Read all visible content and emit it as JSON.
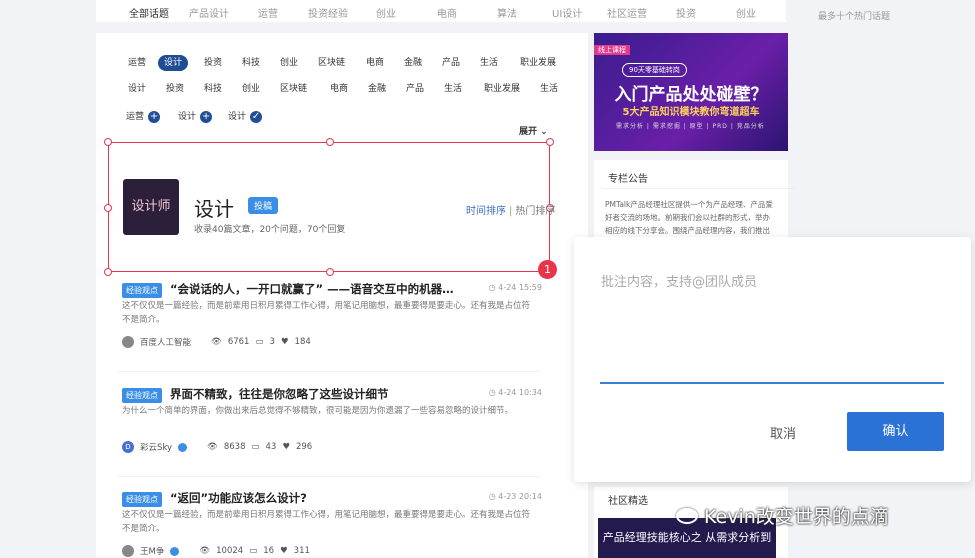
{
  "topnav": {
    "items": [
      "全部话题",
      "产品设计",
      "运营",
      "投资经验",
      "创业",
      "电商",
      "算法",
      "UI设计",
      "社区运营",
      "投资",
      "创业"
    ],
    "hot_caption": "最多十个热门话题"
  },
  "tags": {
    "row1": [
      "运营",
      "设计",
      "投资",
      "科技",
      "创业",
      "区块链",
      "电商",
      "金融",
      "产品",
      "生活",
      "职业发展"
    ],
    "row2": [
      "设计",
      "投资",
      "科技",
      "创业",
      "区块链",
      "电商",
      "金融",
      "产品",
      "生活",
      "职业发展",
      "生活"
    ],
    "chips": [
      {
        "label": "运营",
        "icon": "+"
      },
      {
        "label": "设计",
        "icon": "+"
      },
      {
        "label": "设计",
        "icon": "✓"
      }
    ],
    "expand_label": "展开 ⌄",
    "selected_row1_index": 1
  },
  "topic": {
    "logo_text": "设计师",
    "title": "设计",
    "submit_label": "投稿",
    "stats": "收录40篇文章，20个问题，70个回复",
    "sort_time": "时间排序",
    "sort_hot": "热门排序",
    "selection_badge": "1"
  },
  "articles": [
    {
      "badge": "经验观点",
      "title": "“会说话的人，一开口就赢了” ——语音交互中的机器…",
      "time": "4-24 15:59",
      "excerpt": "这不仅仅是一篇经验，而是前辈用日积月累得工作心得，用笔记用脑想，最重要得是要走心。还有我是占位符不是简介。",
      "author": "百度人工智能",
      "views": "6761",
      "comments": "3",
      "likes": "184"
    },
    {
      "badge": "经验观点",
      "title": "界面不精致，往往是你忽略了这些设计细节",
      "time": "4-24 10:34",
      "excerpt": "为什么一个简单的界面，你做出来后总觉得不够精致，很可能是因为你遗漏了一些容易忽略的设计细节。",
      "author": "彩云Sky",
      "avatar_letter": "D",
      "views": "8638",
      "comments": "43",
      "likes": "296"
    },
    {
      "badge": "经验观点",
      "title": "“返回”功能应该怎么设计?",
      "time": "4-23 20:14",
      "excerpt": "这不仅仅是一篇经验，而是前辈用日积月累得工作心得，用笔记用脑想，最重要得是要走心。还有我是占位符不是简介。",
      "author": "王M争",
      "views": "10024",
      "comments": "16",
      "likes": "311"
    }
  ],
  "banner": {
    "tag": "线上课程",
    "pill": "90天零基础转岗",
    "headline": "入门产品处处碰壁？",
    "subline": "5大产品知识模块教你弯道超车",
    "footer": "需求分析 | 需求挖掘 | 原型 | PRD | 竞品分析"
  },
  "notice": {
    "title": "专栏公告",
    "text": "PMTalk产品经理社区提供一个为产品经理、产品爱好者交流的场地。前期我们会以社群的形式，举办相应的线下分享会。围绕产品经理内容，我们推出以"
  },
  "popup": {
    "placeholder": "批注内容，支持@团队成员",
    "cancel_label": "取消",
    "confirm_label": "确认"
  },
  "picks": {
    "title": "社区精选",
    "image_text": "产品经理技能核心之 从需求分析到运营迭代"
  },
  "watermark": "Kevin改变世界的点滴"
}
